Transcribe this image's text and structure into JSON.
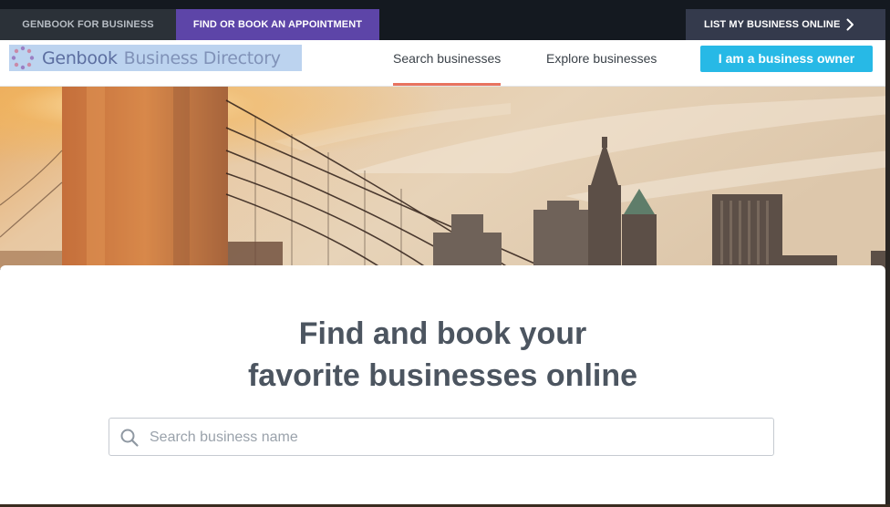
{
  "topbar": {
    "business_label": "GENBOOK FOR BUSINESS",
    "appointment_label": "FIND OR BOOK AN APPOINTMENT",
    "list_label": "LIST MY BUSINESS ONLINE"
  },
  "nav": {
    "logo_brand": "Genbook",
    "logo_rest": "Business Directory",
    "search_link": "Search businesses",
    "explore_link": "Explore businesses",
    "owner_button": "I am a business owner"
  },
  "hero": {
    "headline_line1": "Find and book your",
    "headline_line2": "favorite businesses online"
  },
  "search": {
    "placeholder": "Search business name",
    "value": ""
  },
  "colors": {
    "appointment_bg": "#5d45a8",
    "owner_button_bg": "#27b9e6",
    "active_underline": "#e8735f"
  }
}
